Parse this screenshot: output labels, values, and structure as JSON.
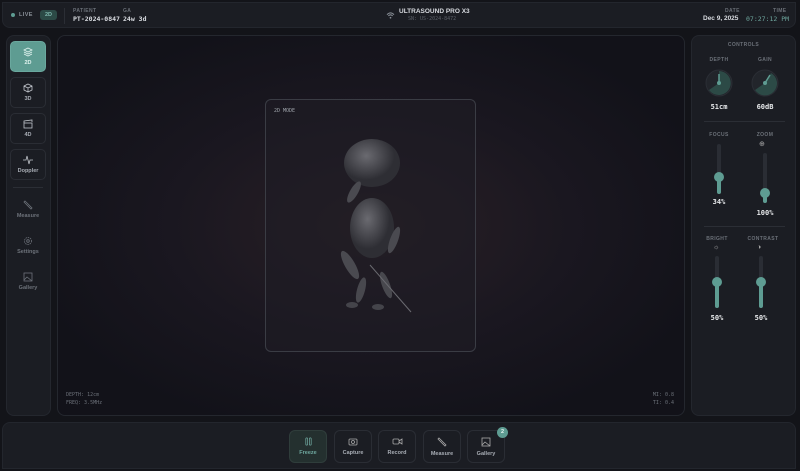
{
  "header": {
    "live": "LIVE",
    "mode_badge": "2D",
    "patient_label": "PATIENT",
    "patient_id": "PT-2024-0847",
    "ga_label": "GA",
    "ga_value": "24w 3d",
    "device_name": "ULTRASOUND PRO X3",
    "serial": "SN: US-2024-8472",
    "date_label": "DATE",
    "date": "Dec 9, 2025",
    "time_label": "TIME",
    "time": "07:27:12 PM"
  },
  "sidebar": {
    "items": [
      {
        "label": "2D",
        "icon": "layers-icon"
      },
      {
        "label": "3D",
        "icon": "cube-icon"
      },
      {
        "label": "4D",
        "icon": "clapperboard-icon"
      },
      {
        "label": "Doppler",
        "icon": "waveform-icon"
      },
      {
        "label": "Measure",
        "icon": "ruler-icon"
      },
      {
        "label": "Settings",
        "icon": "gear-icon"
      },
      {
        "label": "Gallery",
        "icon": "image-icon"
      }
    ]
  },
  "viewport": {
    "mode": "2D MODE",
    "depth": "DEPTH: 12cm",
    "freq": "FREQ: 3.5MHz",
    "mi": "MI: 0.8",
    "ti": "TI: 0.4"
  },
  "controls": {
    "title": "CONTROLS",
    "depth_label": "DEPTH",
    "depth_value": "51cm",
    "gain_label": "GAIN",
    "gain_value": "60dB",
    "focus_label": "FOCUS",
    "focus_value": "34%",
    "focus_level": 34,
    "zoom_label": "ZOOM",
    "zoom_value": "100%",
    "zoom_level": 20,
    "bright_label": "BRIGHT",
    "bright_value": "50%",
    "bright_level": 50,
    "contrast_label": "CONTRAST",
    "contrast_value": "50%",
    "contrast_level": 50
  },
  "toolbar": {
    "freeze": "Freeze",
    "capture": "Capture",
    "record": "Record",
    "measure": "Measure",
    "gallery": "Gallery",
    "gallery_count": "2"
  },
  "colors": {
    "accent": "#5e9c92",
    "background": "#131419"
  }
}
